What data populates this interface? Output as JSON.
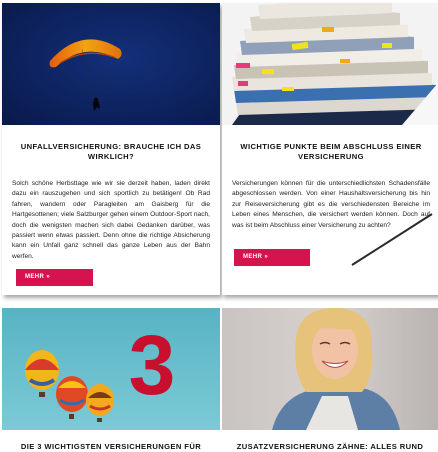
{
  "cards": [
    {
      "title": "Unfallversicherung: Brauche ich das wirklich?",
      "text": "Solch schöne Herbsttage wie wir sie derzeit haben, laden direkt dazu ein rauszugehen und sich sportlich zu betätigen! Ob Rad fahren, wandern oder Paragleiten am Gaisberg für die Hartgesottenen; viele Salzburger gehen einem Outdoor-Sport nach, doch die wenigsten machen sich dabei Gedanken darüber, was passiert wenn etwas passiert. Denn ohne die richtige Absicherung kann ein Unfall ganz schnell das ganze Leben aus der Bahn werfen.",
      "button": "MEHR »"
    },
    {
      "title": "Wichtige Punkte beim Abschluss einer Versicherung",
      "text": "Versicherungen können für die unterschiedlichsten Schadensfälle abgeschlossen werden. Von einer Haushaltsversicherung bis hin zur Reiseversicherung gibt es die verschiedensten Bereiche im Leben eines Menschen, die versichert werden können. Doch auf was ist beim Abschluss einer Versicherung zu achten?",
      "button": "MEHR »"
    },
    {
      "title": "Die 3 wichtigsten Versicherungen für"
    },
    {
      "title": "Zusatzversicherung Zähne: Alles rund"
    }
  ],
  "image3_numeral": "3",
  "colors": {
    "accent": "#d4134f",
    "sky_dark": "#0b1f5c",
    "sky_light": "#5fb8c9",
    "numeral": "#c8102e"
  },
  "icons": {
    "paraglider": "paraglider-icon",
    "person": "person-silhouette-icon"
  }
}
